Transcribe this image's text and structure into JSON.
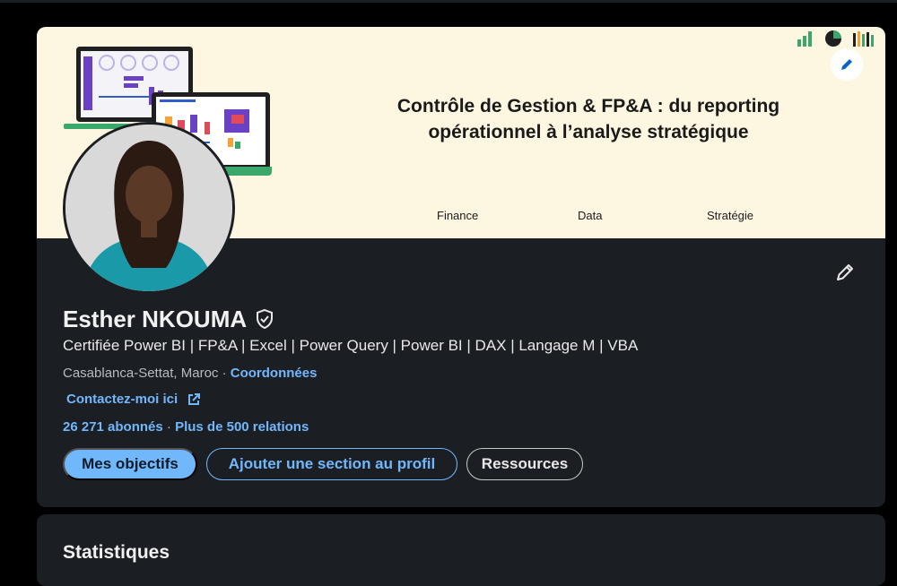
{
  "banner": {
    "title_line1": "Contrôle de Gestion & FP&A : du reporting",
    "title_line2": "opérationnel à l’analyse stratégique",
    "tags": [
      "Finance",
      "Data",
      "Stratégie"
    ],
    "edit_icon": "pencil-icon",
    "deco_icons": [
      "bar-chart-icon",
      "pie-chart-icon",
      "column-chart-icon"
    ]
  },
  "profile": {
    "name": "Esther NKOUMA",
    "verified_icon": "verified-shield-icon",
    "headline": "Certifiée Power BI | FP&A | Excel | Power Query | Power BI | DAX | Langage M | VBA",
    "location": "Casablanca-Settat, Maroc",
    "location_sep": " · ",
    "contact_info_link": "Coordonnées",
    "website_link": "Contactez-moi ici",
    "followers": "26 271 abonnés",
    "network_sep": " · ",
    "connections": "Plus de 500 relations",
    "edit_icon": "pencil-icon"
  },
  "actions": {
    "primary": "Mes objectifs",
    "add_section": "Ajouter une section au profil",
    "resources": "Ressources"
  },
  "stats": {
    "title": "Statistiques"
  },
  "colors": {
    "page_bg": "#000000",
    "card_bg": "#1b1f23",
    "banner_bg": "#fdf6e0",
    "accent": "#71b7fb",
    "banner_green": "#3aa86b"
  }
}
